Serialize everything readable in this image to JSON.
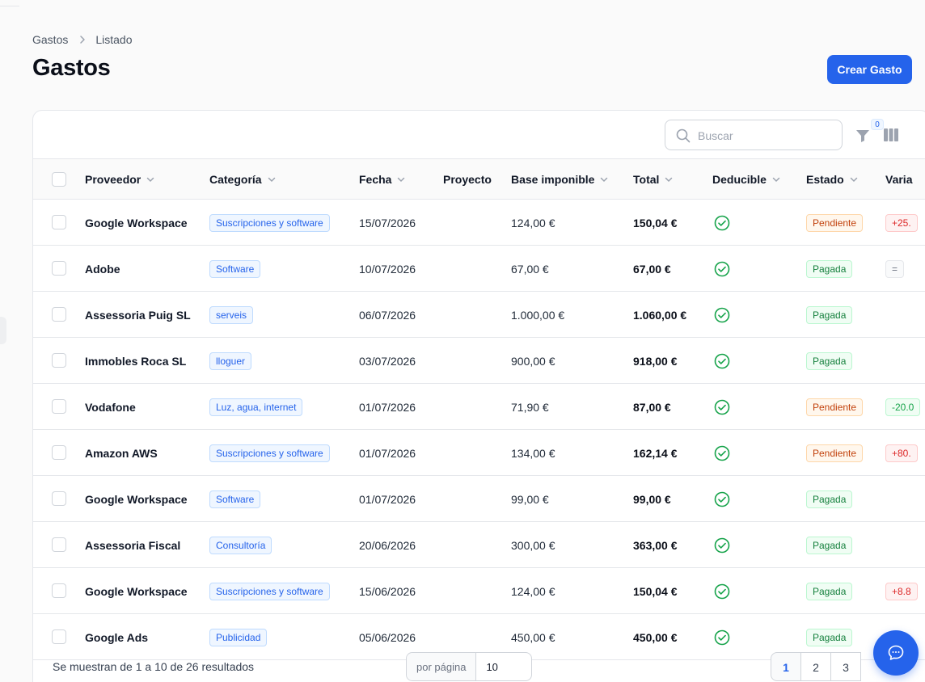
{
  "breadcrumb": {
    "parent": "Gastos",
    "current": "Listado"
  },
  "page_title": "Gastos",
  "create_button_label": "Crear Gasto",
  "search": {
    "placeholder": "Buscar",
    "value": ""
  },
  "filter_count": "0",
  "columns": {
    "proveedor": "Proveedor",
    "categoria": "Categoría",
    "fecha": "Fecha",
    "proyecto": "Proyecto",
    "base": "Base imponible",
    "total": "Total",
    "deducible": "Deducible",
    "estado": "Estado",
    "variacion": "Varia"
  },
  "rows": [
    {
      "proveedor": "Google Workspace",
      "categoria": "Suscripciones y software",
      "fecha": "15/07/2026",
      "base": "124,00 €",
      "total": "150,04 €",
      "deducible": "check-circle-icon",
      "estado": "Pendiente",
      "estado_type": "pend",
      "variacion": "+25.",
      "var_type": "up"
    },
    {
      "proveedor": "Adobe",
      "categoria": "Software",
      "fecha": "10/07/2026",
      "base": "67,00 €",
      "total": "67,00 €",
      "deducible": "check-circle-icon",
      "estado": "Pagada",
      "estado_type": "paid",
      "variacion": "=",
      "var_type": "eq"
    },
    {
      "proveedor": "Assessoria Puig SL",
      "categoria": "serveis",
      "fecha": "06/07/2026",
      "base": "1.000,00 €",
      "total": "1.060,00 €",
      "deducible": "check-circle-icon",
      "estado": "Pagada",
      "estado_type": "paid",
      "variacion": "",
      "var_type": ""
    },
    {
      "proveedor": "Immobles Roca SL",
      "categoria": "lloguer",
      "fecha": "03/07/2026",
      "base": "900,00 €",
      "total": "918,00 €",
      "deducible": "check-circle-icon",
      "estado": "Pagada",
      "estado_type": "paid",
      "variacion": "",
      "var_type": ""
    },
    {
      "proveedor": "Vodafone",
      "categoria": "Luz, agua, internet",
      "fecha": "01/07/2026",
      "base": "71,90 €",
      "total": "87,00 €",
      "deducible": "check-circle-icon",
      "estado": "Pendiente",
      "estado_type": "pend",
      "variacion": "-20.0",
      "var_type": "down"
    },
    {
      "proveedor": "Amazon AWS",
      "categoria": "Suscripciones y software",
      "fecha": "01/07/2026",
      "base": "134,00 €",
      "total": "162,14 €",
      "deducible": "check-circle-icon",
      "estado": "Pendiente",
      "estado_type": "pend",
      "variacion": "+80.",
      "var_type": "up"
    },
    {
      "proveedor": "Google Workspace",
      "categoria": "Software",
      "fecha": "01/07/2026",
      "base": "99,00 €",
      "total": "99,00 €",
      "deducible": "check-circle-icon",
      "estado": "Pagada",
      "estado_type": "paid",
      "variacion": "",
      "var_type": ""
    },
    {
      "proveedor": "Assessoria Fiscal",
      "categoria": "Consultoría",
      "fecha": "20/06/2026",
      "base": "300,00 €",
      "total": "363,00 €",
      "deducible": "check-circle-icon",
      "estado": "Pagada",
      "estado_type": "paid",
      "variacion": "",
      "var_type": ""
    },
    {
      "proveedor": "Google Workspace",
      "categoria": "Suscripciones y software",
      "fecha": "15/06/2026",
      "base": "124,00 €",
      "total": "150,04 €",
      "deducible": "check-circle-icon",
      "estado": "Pagada",
      "estado_type": "paid",
      "variacion": "+8.8",
      "var_type": "up"
    },
    {
      "proveedor": "Google Ads",
      "categoria": "Publicidad",
      "fecha": "05/06/2026",
      "base": "450,00 €",
      "total": "450,00 €",
      "deducible": "check-circle-icon",
      "estado": "Pagada",
      "estado_type": "paid",
      "variacion": "",
      "var_type": ""
    }
  ],
  "footer": {
    "results_text": "Se muestran de 1 a 10 de 26 resultados",
    "per_page_label": "por página",
    "per_page_value": "10",
    "pages": [
      "1",
      "2",
      "3"
    ],
    "current_page": "1"
  },
  "colors": {
    "primary": "#2563eb",
    "pending": "#c2410c",
    "paid": "#15803d",
    "check": "#16a34a"
  },
  "icons": {
    "search": "search-icon",
    "filter": "filter-icon",
    "columns": "columns-icon",
    "chat": "chat-bubble-icon"
  }
}
